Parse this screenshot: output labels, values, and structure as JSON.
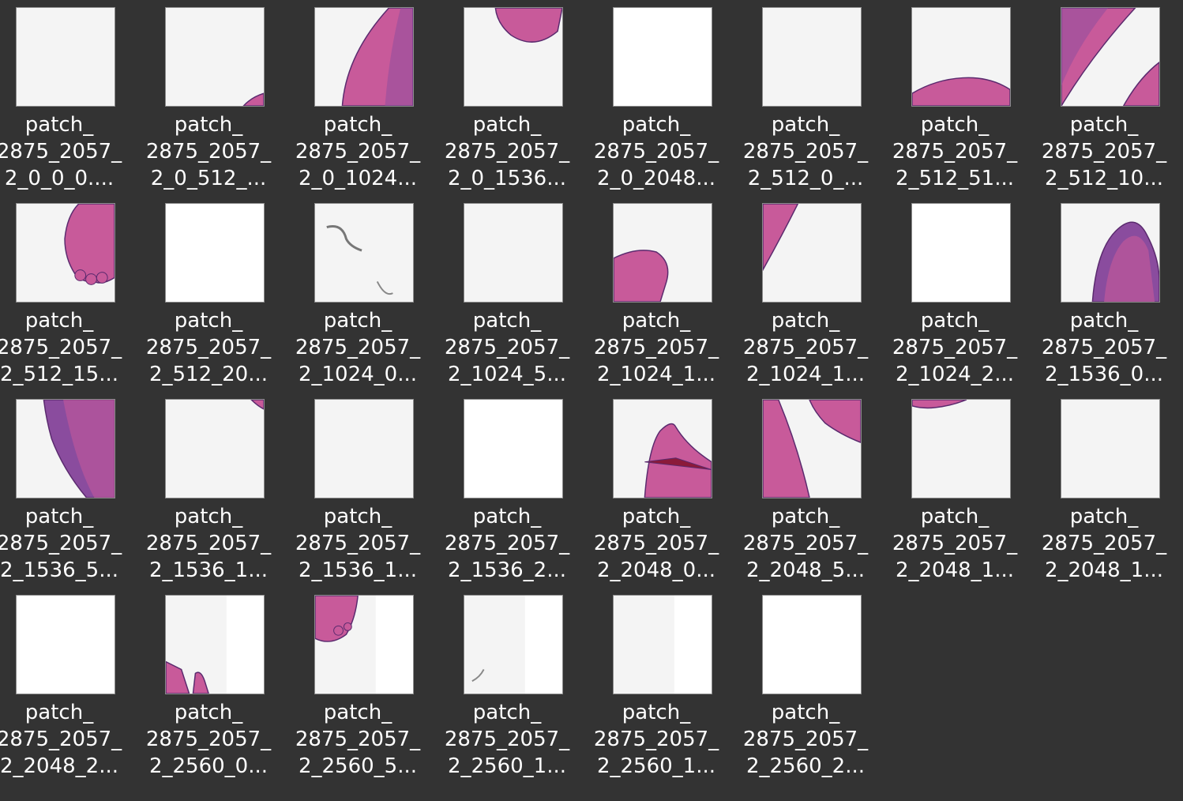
{
  "files": [
    {
      "name_lines": [
        "patch_",
        "2875_2057_",
        "2_0_0_0...."
      ],
      "thumb": {
        "bg": "#f4f4f4",
        "tissue": "none"
      }
    },
    {
      "name_lines": [
        "patch_",
        "2875_2057_",
        "2_0_512_..."
      ],
      "thumb": {
        "bg": "#f4f4f4",
        "tissue": "corner-bottom-right-small"
      }
    },
    {
      "name_lines": [
        "patch_",
        "2875_2057_",
        "2_0_1024..."
      ],
      "thumb": {
        "bg": "#f4f4f4",
        "tissue": "right-diagonal-large"
      }
    },
    {
      "name_lines": [
        "patch_",
        "2875_2057_",
        "2_0_1536..."
      ],
      "thumb": {
        "bg": "#f4f4f4",
        "tissue": "top-right-lobe"
      }
    },
    {
      "name_lines": [
        "patch_",
        "2875_2057_",
        "2_0_2048..."
      ],
      "thumb": {
        "bg": "#ffffff",
        "tissue": "none"
      }
    },
    {
      "name_lines": [
        "patch_",
        "2875_2057_",
        "2_512_0_..."
      ],
      "thumb": {
        "bg": "#f4f4f4",
        "tissue": "none"
      }
    },
    {
      "name_lines": [
        "patch_",
        "2875_2057_",
        "2_512_51..."
      ],
      "thumb": {
        "bg": "#f4f4f4",
        "tissue": "bottom-band"
      }
    },
    {
      "name_lines": [
        "patch_",
        "2875_2057_",
        "2_512_10..."
      ],
      "thumb": {
        "bg": "#f4f4f4",
        "tissue": "diagonal-band"
      }
    },
    {
      "name_lines": [
        "patch_",
        "2875_2057_",
        "2_512_15..."
      ],
      "thumb": {
        "bg": "#f4f4f4",
        "tissue": "right-lobe-villi"
      }
    },
    {
      "name_lines": [
        "patch_",
        "2875_2057_",
        "2_512_20..."
      ],
      "thumb": {
        "bg": "#ffffff",
        "tissue": "none"
      }
    },
    {
      "name_lines": [
        "patch_",
        "2875_2057_",
        "2_1024_0..."
      ],
      "thumb": {
        "bg": "#f4f4f4",
        "tissue": "streak"
      }
    },
    {
      "name_lines": [
        "patch_",
        "2875_2057_",
        "2_1024_5..."
      ],
      "thumb": {
        "bg": "#f4f4f4",
        "tissue": "none"
      }
    },
    {
      "name_lines": [
        "patch_",
        "2875_2057_",
        "2_1024_1..."
      ],
      "thumb": {
        "bg": "#f4f4f4",
        "tissue": "bottom-left-blob"
      }
    },
    {
      "name_lines": [
        "patch_",
        "2875_2057_",
        "2_1024_1..."
      ],
      "thumb": {
        "bg": "#f4f4f4",
        "tissue": "left-top-wedge"
      }
    },
    {
      "name_lines": [
        "patch_",
        "2875_2057_",
        "2_1024_2..."
      ],
      "thumb": {
        "bg": "#ffffff",
        "tissue": "none"
      }
    },
    {
      "name_lines": [
        "patch_",
        "2875_2057_",
        "2_1536_0..."
      ],
      "thumb": {
        "bg": "#f4f4f4",
        "tissue": "right-mound"
      }
    },
    {
      "name_lines": [
        "patch_",
        "2875_2057_",
        "2_1536_5..."
      ],
      "thumb": {
        "bg": "#f4f4f4",
        "tissue": "right-half"
      }
    },
    {
      "name_lines": [
        "patch_",
        "2875_2057_",
        "2_1536_1..."
      ],
      "thumb": {
        "bg": "#f4f4f4",
        "tissue": "corner-top-right-small"
      }
    },
    {
      "name_lines": [
        "patch_",
        "2875_2057_",
        "2_1536_1..."
      ],
      "thumb": {
        "bg": "#f4f4f4",
        "tissue": "none"
      }
    },
    {
      "name_lines": [
        "patch_",
        "2875_2057_",
        "2_1536_2..."
      ],
      "thumb": {
        "bg": "#ffffff",
        "tissue": "none"
      }
    },
    {
      "name_lines": [
        "patch_",
        "2875_2057_",
        "2_2048_0..."
      ],
      "thumb": {
        "bg": "#f4f4f4",
        "tissue": "fold-center"
      }
    },
    {
      "name_lines": [
        "patch_",
        "2875_2057_",
        "2_2048_5..."
      ],
      "thumb": {
        "bg": "#f4f4f4",
        "tissue": "left-and-right-bands"
      }
    },
    {
      "name_lines": [
        "patch_",
        "2875_2057_",
        "2_2048_1..."
      ],
      "thumb": {
        "bg": "#f4f4f4",
        "tissue": "top-edge-thin"
      }
    },
    {
      "name_lines": [
        "patch_",
        "2875_2057_",
        "2_2048_1..."
      ],
      "thumb": {
        "bg": "#f4f4f4",
        "tissue": "none"
      }
    },
    {
      "name_lines": [
        "patch_",
        "2875_2057_",
        "2_2048_2..."
      ],
      "thumb": {
        "bg": "#ffffff",
        "tissue": "none"
      }
    },
    {
      "name_lines": [
        "patch_",
        "2875_2057_",
        "2_2560_0..."
      ],
      "thumb": {
        "bg": "#f4f4f4",
        "tissue": "half-white-bottom-left"
      }
    },
    {
      "name_lines": [
        "patch_",
        "2875_2057_",
        "2_2560_5..."
      ],
      "thumb": {
        "bg": "#f4f4f4",
        "tissue": "half-white-top-left"
      }
    },
    {
      "name_lines": [
        "patch_",
        "2875_2057_",
        "2_2560_1..."
      ],
      "thumb": {
        "bg": "#f4f4f4",
        "tissue": "half-white-streak"
      }
    },
    {
      "name_lines": [
        "patch_",
        "2875_2057_",
        "2_2560_1..."
      ],
      "thumb": {
        "bg": "#f4f4f4",
        "tissue": "half-white"
      }
    },
    {
      "name_lines": [
        "patch_",
        "2875_2057_",
        "2_2560_2..."
      ],
      "thumb": {
        "bg": "#ffffff",
        "tissue": "none"
      }
    }
  ],
  "colors": {
    "background": "#333333",
    "label_text": "#ffffff",
    "tissue_pink": "#c85a9a",
    "tissue_purple": "#8a4c9e",
    "tissue_dark": "#5a2a6e",
    "fold_red": "#8b1a3a"
  }
}
